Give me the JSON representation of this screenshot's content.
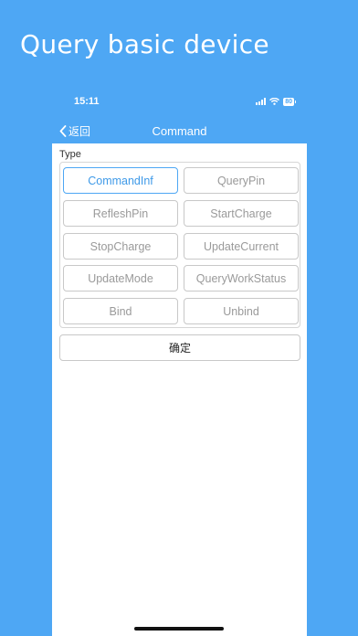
{
  "promo": {
    "title": "Query basic device"
  },
  "status_bar": {
    "time": "15:11",
    "battery": "80"
  },
  "navbar": {
    "back_label": "返回",
    "title": "Command"
  },
  "form": {
    "type_label": "Type",
    "options": [
      {
        "label": "CommandInf",
        "selected": true
      },
      {
        "label": "QueryPin",
        "selected": false
      },
      {
        "label": "RefleshPin",
        "selected": false
      },
      {
        "label": "StartCharge",
        "selected": false
      },
      {
        "label": "StopCharge",
        "selected": false
      },
      {
        "label": "UpdateCurrent",
        "selected": false
      },
      {
        "label": "UpdateMode",
        "selected": false
      },
      {
        "label": "QueryWorkStatus",
        "selected": false
      },
      {
        "label": "Bind",
        "selected": false
      },
      {
        "label": "Unbind",
        "selected": false
      }
    ],
    "confirm_label": "确定"
  },
  "colors": {
    "background": "#4ea7f4",
    "accent": "#3f9ae8"
  },
  "icons": {
    "back": "chevron-left-icon",
    "signal": "signal-icon",
    "wifi": "wifi-icon",
    "battery": "battery-icon"
  }
}
